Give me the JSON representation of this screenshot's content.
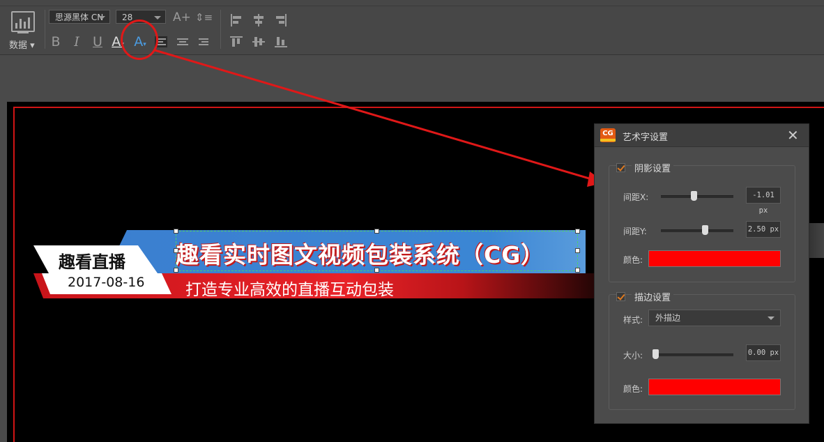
{
  "toolbar": {
    "data_label": "数据",
    "font_family": "思源黑体 CN",
    "font_size": "28",
    "grow_font_icon": "A+",
    "bold": "B",
    "italic": "I",
    "underline": "U",
    "font_color": "A",
    "art_text": "A"
  },
  "canvas": {
    "badge_title": "趣看直播",
    "badge_date": "2017-08-16",
    "main_title": "趣看实时图文视频包装系统（CG）",
    "sub_title": "打造专业高效的直播互动包装"
  },
  "dialog": {
    "title": "艺术字设置",
    "logo_text": "CG",
    "close": "✕",
    "shadow": {
      "label": "阴影设置",
      "checked": true,
      "offset_x_label": "间距X:",
      "offset_x_value": "-1.01 px",
      "offset_x_level": 0.45,
      "offset_y_label": "间距Y:",
      "offset_y_value": "2.50 px",
      "offset_y_level": 0.61,
      "color_label": "颜色:",
      "color": "#ff0000"
    },
    "stroke": {
      "label": "描边设置",
      "checked": true,
      "style_label": "样式:",
      "style_value": "外描边",
      "size_label": "大小:",
      "size_value": "0.00 px",
      "size_level": 0.0,
      "color_label": "颜色:",
      "color": "#ff0000"
    }
  },
  "colors": {
    "accent_red": "#e01818",
    "banner_blue": "#3b86d4",
    "checkbox_orange": "#e07a20"
  }
}
